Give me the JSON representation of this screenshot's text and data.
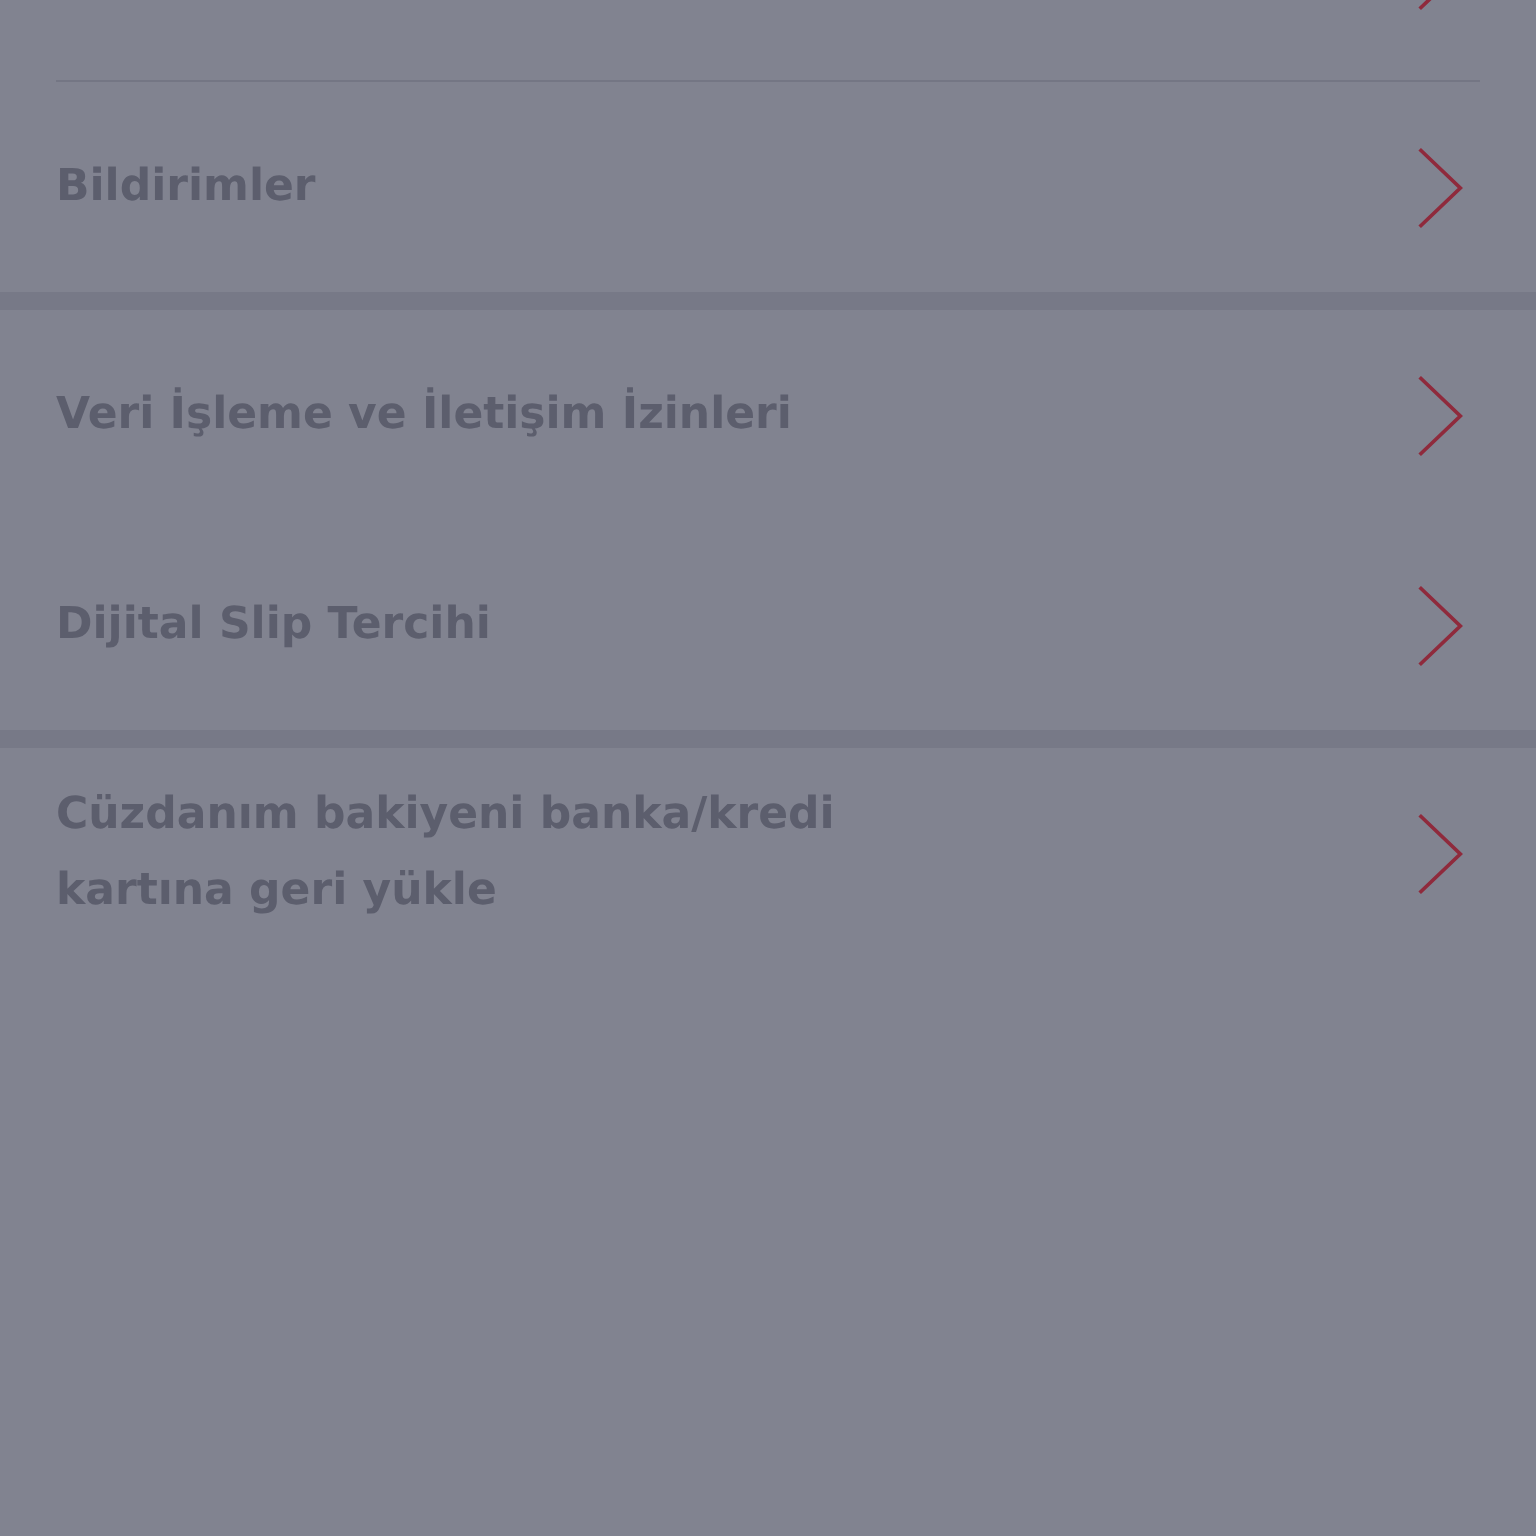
{
  "sections": [
    {
      "items": [
        {
          "label": "Bildirimler"
        }
      ]
    },
    {
      "items": [
        {
          "label": "Veri İşleme ve İletişim İzinleri"
        },
        {
          "label": "Dijital Slip Tercihi"
        }
      ]
    },
    {
      "items": [
        {
          "label": "Cüzdanım bakiyeni banka/kredi kartına geri yükle"
        }
      ]
    }
  ]
}
